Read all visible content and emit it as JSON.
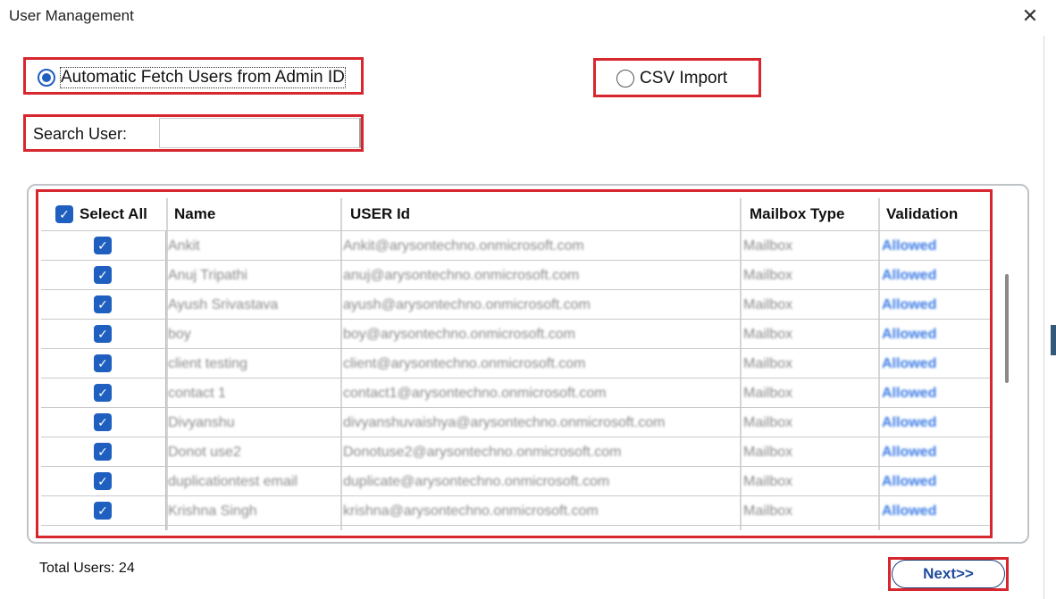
{
  "window": {
    "title": "User Management",
    "close_glyph": "✕"
  },
  "mode": {
    "auto_label": "Automatic Fetch Users from Admin ID",
    "csv_label": "CSV Import",
    "selected": "auto"
  },
  "search": {
    "label": "Search User:",
    "value": "",
    "placeholder": ""
  },
  "table": {
    "select_all_label": "Select All",
    "columns": [
      "Name",
      "USER Id",
      "Mailbox Type",
      "Validation"
    ],
    "rows": [
      {
        "checked": true,
        "name": "Ankit",
        "user_id": "Ankit@arysontechno.onmicrosoft.com",
        "mailbox_type": "Mailbox",
        "validation": "Allowed"
      },
      {
        "checked": true,
        "name": "Anuj Tripathi",
        "user_id": "anuj@arysontechno.onmicrosoft.com",
        "mailbox_type": "Mailbox",
        "validation": "Allowed"
      },
      {
        "checked": true,
        "name": "Ayush Srivastava",
        "user_id": "ayush@arysontechno.onmicrosoft.com",
        "mailbox_type": "Mailbox",
        "validation": "Allowed"
      },
      {
        "checked": true,
        "name": "boy",
        "user_id": "boy@arysontechno.onmicrosoft.com",
        "mailbox_type": "Mailbox",
        "validation": "Allowed"
      },
      {
        "checked": true,
        "name": "client testing",
        "user_id": "client@arysontechno.onmicrosoft.com",
        "mailbox_type": "Mailbox",
        "validation": "Allowed"
      },
      {
        "checked": true,
        "name": "contact 1",
        "user_id": "contact1@arysontechno.onmicrosoft.com",
        "mailbox_type": "Mailbox",
        "validation": "Allowed"
      },
      {
        "checked": true,
        "name": "Divyanshu",
        "user_id": "divyanshuvaishya@arysontechno.onmicrosoft.com",
        "mailbox_type": "Mailbox",
        "validation": "Allowed"
      },
      {
        "checked": true,
        "name": "Donot use2",
        "user_id": "Donotuse2@arysontechno.onmicrosoft.com",
        "mailbox_type": "Mailbox",
        "validation": "Allowed"
      },
      {
        "checked": true,
        "name": "duplicationtest email",
        "user_id": "duplicate@arysontechno.onmicrosoft.com",
        "mailbox_type": "Mailbox",
        "validation": "Allowed"
      },
      {
        "checked": true,
        "name": "Krishna Singh",
        "user_id": "krishna@arysontechno.onmicrosoft.com",
        "mailbox_type": "Mailbox",
        "validation": "Allowed"
      }
    ]
  },
  "footer": {
    "total_label": "Total Users: 24",
    "next_label": "Next>>"
  },
  "colors": {
    "highlight": "#d7262e",
    "accent": "#1f5fbf",
    "allowed": "#3d7ce6"
  }
}
